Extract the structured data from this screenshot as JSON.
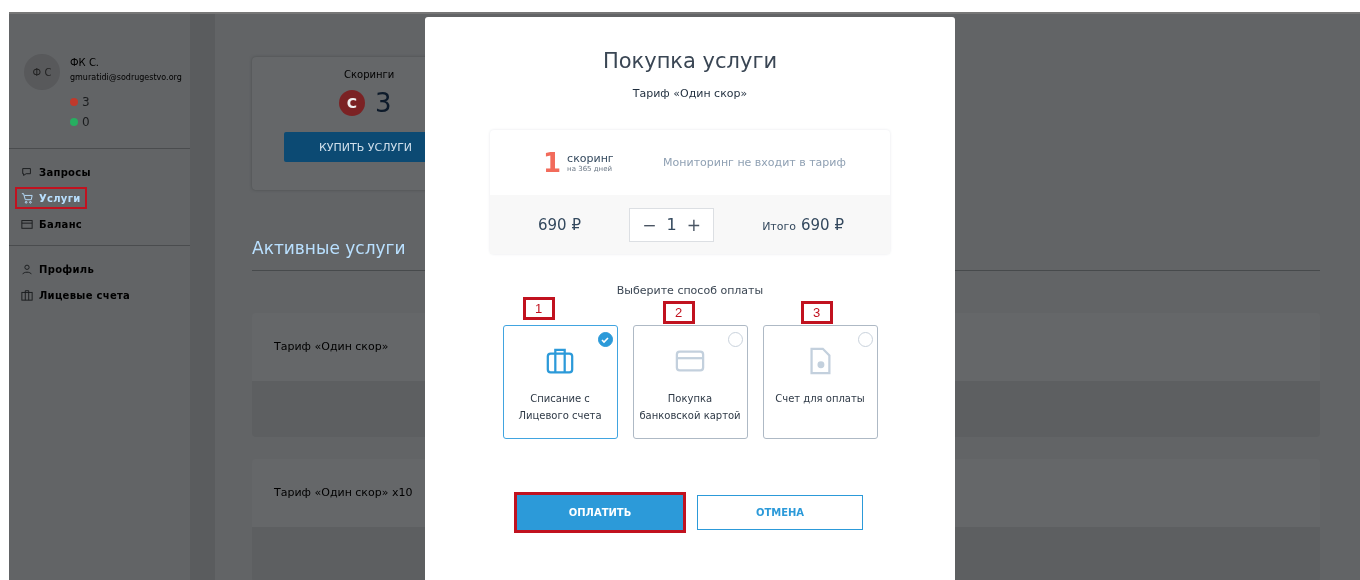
{
  "sidebar": {
    "avatar": "Ф С",
    "name": "ФК С.",
    "email": "gmuratidi@sodrugestvo.org",
    "balances": [
      {
        "value": "3",
        "color": "#c0392b"
      },
      {
        "value": "0",
        "color": "#27ae60"
      }
    ],
    "nav_groups": [
      [
        {
          "label": "Запросы",
          "kind": "chat",
          "selected": false,
          "highlighted": false
        },
        {
          "label": "Услуги",
          "kind": "cart",
          "selected": true,
          "highlighted": true
        },
        {
          "label": "Баланс",
          "kind": "wallet",
          "selected": false,
          "highlighted": false
        }
      ],
      [
        {
          "label": "Профиль",
          "kind": "user",
          "selected": false,
          "highlighted": false
        },
        {
          "label": "Лицевые счета",
          "kind": "case",
          "selected": false,
          "highlighted": false
        }
      ]
    ]
  },
  "main": {
    "scoring_card": {
      "label": "Скоринги",
      "badge": "С",
      "value": "3",
      "button": "КУПИТЬ УСЛУГИ"
    },
    "section_title": "Активные услуги",
    "services": [
      "Тариф «Один скор»",
      "Тариф «Один скор» x10"
    ]
  },
  "modal": {
    "title": "Покупка услуги",
    "subtitle": "Тариф «Один скор»",
    "count": "1",
    "unit": "скоринг",
    "period": "на 365 дней",
    "note": "Мониторинг не входит в тариф",
    "price": "690 ₽",
    "stepper": {
      "minus": "−",
      "value": "1",
      "plus": "+"
    },
    "total_label": "Итого",
    "total": "690 ₽",
    "payment_prompt": "Выберите способ оплаты",
    "methods": [
      {
        "label": "Списание с Лицевого счета",
        "kind": "case",
        "selected": true,
        "annotation": "1"
      },
      {
        "label": "Покупка банковской картой",
        "kind": "card",
        "selected": false,
        "annotation": "2"
      },
      {
        "label": "Счет для оплаты",
        "kind": "doc",
        "selected": false,
        "annotation": "3"
      }
    ],
    "pay_button": {
      "label": "ОПЛАТИТЬ",
      "highlighted": true
    },
    "cancel_button": {
      "label": "ОТМЕНА"
    }
  }
}
